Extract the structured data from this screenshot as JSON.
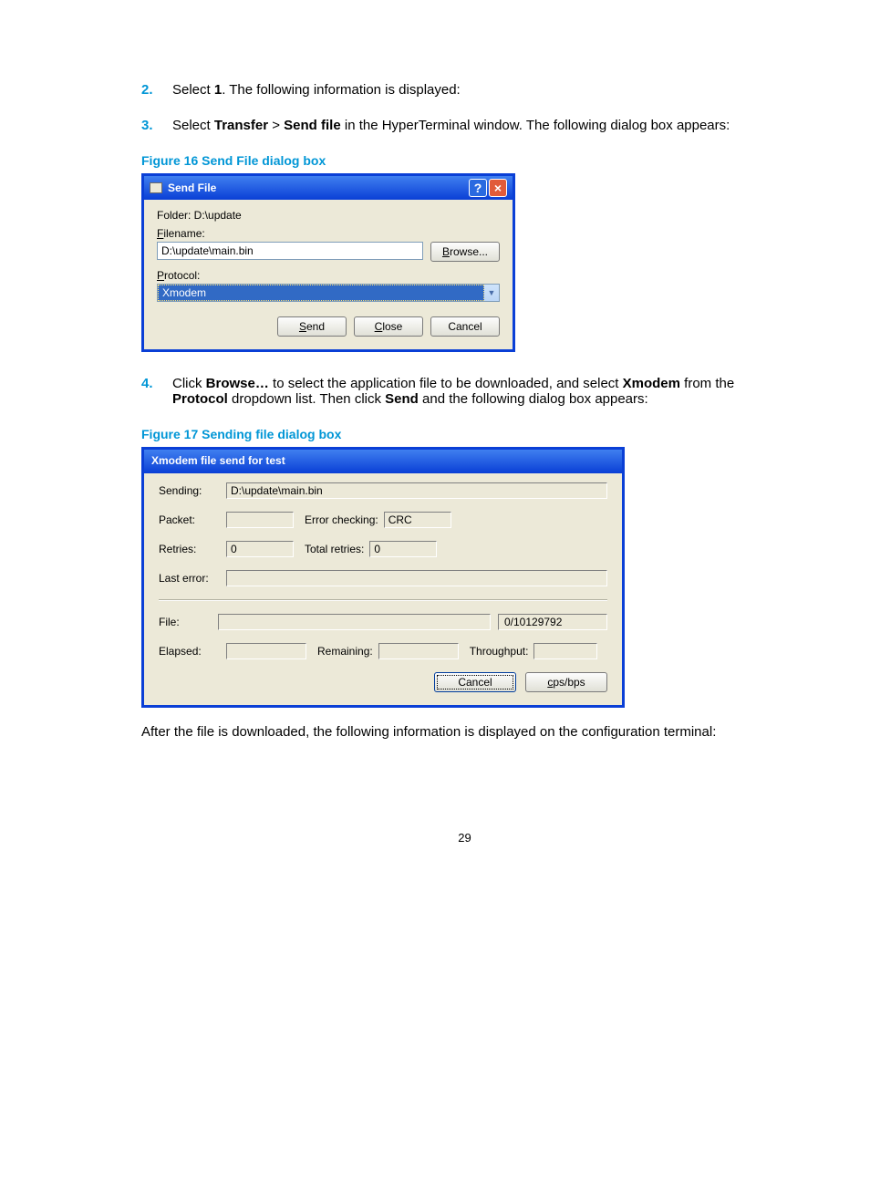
{
  "steps": {
    "s2": {
      "num": "2.",
      "pre": "Select ",
      "bold": "1",
      "post": ". The following information is displayed:"
    },
    "s3": {
      "num": "3.",
      "pre": "Select ",
      "b1": "Transfer",
      "sep": " > ",
      "b2": "Send file",
      "post": " in the HyperTerminal window. The following dialog box appears:"
    },
    "s4": {
      "num": "4.",
      "p1": "Click ",
      "b1": "Browse…",
      "p2": " to select the application file to be downloaded, and select ",
      "b2": "Xmodem",
      "p3": " from the ",
      "b3": "Protocol",
      "p4": " dropdown list. Then click ",
      "b4": "Send",
      "p5": " and the following dialog box appears:"
    }
  },
  "fig16": {
    "caption": "Figure 16 Send File dialog box"
  },
  "fig17": {
    "caption": "Figure 17 Sending file dialog box"
  },
  "after": "After the file is downloaded, the following information is displayed on the configuration terminal:",
  "page_number": "29",
  "sendFileDialog": {
    "title": "Send File",
    "folder_label": "Folder: D:\\update",
    "filename_label": "Filename:",
    "filename_value": "D:\\update\\main.bin",
    "browse_btn": "Browse...",
    "protocol_label": "Protocol:",
    "protocol_value": "Xmodem",
    "buttons": {
      "send": "Send",
      "close": "Close",
      "cancel": "Cancel"
    }
  },
  "sendingDialog": {
    "title": "Xmodem file send for test",
    "labels": {
      "sending": "Sending:",
      "packet": "Packet:",
      "error_checking": "Error checking:",
      "retries": "Retries:",
      "total_retries": "Total retries:",
      "last_error": "Last error:",
      "file": "File:",
      "elapsed": "Elapsed:",
      "remaining": "Remaining:",
      "throughput": "Throughput:"
    },
    "values": {
      "sending": "D:\\update\\main.bin",
      "packet": "",
      "error_checking": "CRC",
      "retries": "0",
      "total_retries": "0",
      "last_error": "",
      "file_progress": "0/10129792",
      "elapsed": "",
      "remaining": "",
      "throughput": ""
    },
    "buttons": {
      "cancel": "Cancel",
      "cpsbps": "cps/bps"
    }
  }
}
